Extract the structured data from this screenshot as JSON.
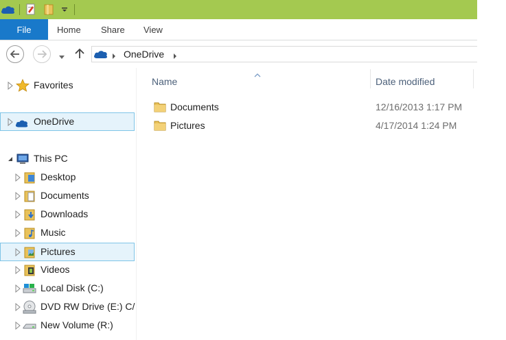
{
  "ribbon": {
    "tabs": [
      "File",
      "Home",
      "Share",
      "View"
    ]
  },
  "address": {
    "location": "OneDrive"
  },
  "nav": {
    "favorites": "Favorites",
    "onedrive": "OneDrive",
    "thispc": "This PC",
    "items": [
      "Desktop",
      "Documents",
      "Downloads",
      "Music",
      "Pictures",
      "Videos",
      "Local Disk (C:)",
      "DVD RW Drive (E:) C/",
      "New Volume (R:)"
    ]
  },
  "columns": {
    "name": "Name",
    "date": "Date modified"
  },
  "files": [
    {
      "name": "Documents",
      "date": "12/16/2013 1:17 PM"
    },
    {
      "name": "Pictures",
      "date": "4/17/2014 1:24 PM"
    }
  ],
  "colors": {
    "titlebar": "#a4c950",
    "file_tab": "#1979ca",
    "selection": "#e5f3fb",
    "selection_border": "#7ec4e7"
  }
}
